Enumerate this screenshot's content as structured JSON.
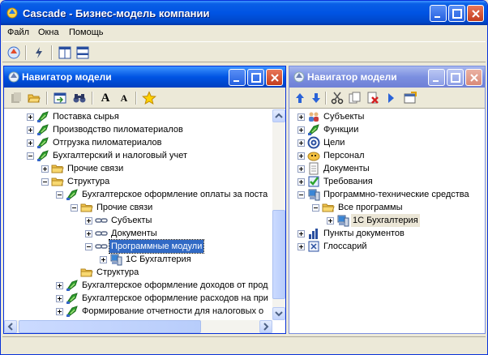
{
  "window": {
    "title": "Cascade - Бизнес-модель компании"
  },
  "menu": [
    "Файл",
    "Окна",
    "Помощь"
  ],
  "left_panel": {
    "title": "Навигатор модели",
    "toolbar_text_buttons": [
      "A",
      "A"
    ],
    "rows": [
      {
        "label": "Поставка сырья",
        "icon": "process-icon"
      },
      {
        "label": "Производство пиломатериалов",
        "icon": "process-icon"
      },
      {
        "label": "Отгрузка пиломатериалов",
        "icon": "process-icon"
      },
      {
        "label": "Бухгалтерский и налоговый учет",
        "icon": "process-icon"
      },
      {
        "label": "Прочие связи",
        "icon": "folder-icon"
      },
      {
        "label": "Структура",
        "icon": "folder-icon"
      },
      {
        "label": "Бухгалтерское оформление оплаты за поста",
        "icon": "process-icon"
      },
      {
        "label": "Прочие связи",
        "icon": "folder-icon"
      },
      {
        "label": "Субъекты",
        "icon": "link-icon"
      },
      {
        "label": "Документы",
        "icon": "link-icon"
      },
      {
        "label": "Программные модули",
        "icon": "link-icon"
      },
      {
        "label": "1С Бухгалтерия",
        "icon": "computer-icon"
      },
      {
        "label": "Структура",
        "icon": "folder-icon"
      },
      {
        "label": "Бухгалтерское оформление доходов от прод",
        "icon": "process-icon"
      },
      {
        "label": "Бухгалтерское оформление расходов на при",
        "icon": "process-icon"
      },
      {
        "label": "Формирование отчетности для налоговых о",
        "icon": "process-icon"
      }
    ]
  },
  "right_panel": {
    "title": "Навигатор модели",
    "rows": [
      {
        "label": "Субъекты",
        "icon": "people-icon"
      },
      {
        "label": "Функции",
        "icon": "process-icon"
      },
      {
        "label": "Цели",
        "icon": "target-icon"
      },
      {
        "label": "Персонал",
        "icon": "person-icon"
      },
      {
        "label": "Документы",
        "icon": "document-icon"
      },
      {
        "label": "Требования",
        "icon": "check-icon"
      },
      {
        "label": "Программно-технические средства",
        "icon": "computer-icon"
      },
      {
        "label": "Все программы",
        "icon": "folder-icon"
      },
      {
        "label": "1С Бухгалтерия",
        "icon": "computer-icon"
      },
      {
        "label": "Пункты документов",
        "icon": "chart-icon"
      },
      {
        "label": "Глоссарий",
        "icon": "glossary-icon"
      }
    ]
  },
  "colors": {
    "title_active": "#0054e3",
    "title_inactive": "#7b8fe0",
    "selection": "#316ac5",
    "process_green": "#2a9d2a",
    "folder_yellow": "#f4c542"
  }
}
